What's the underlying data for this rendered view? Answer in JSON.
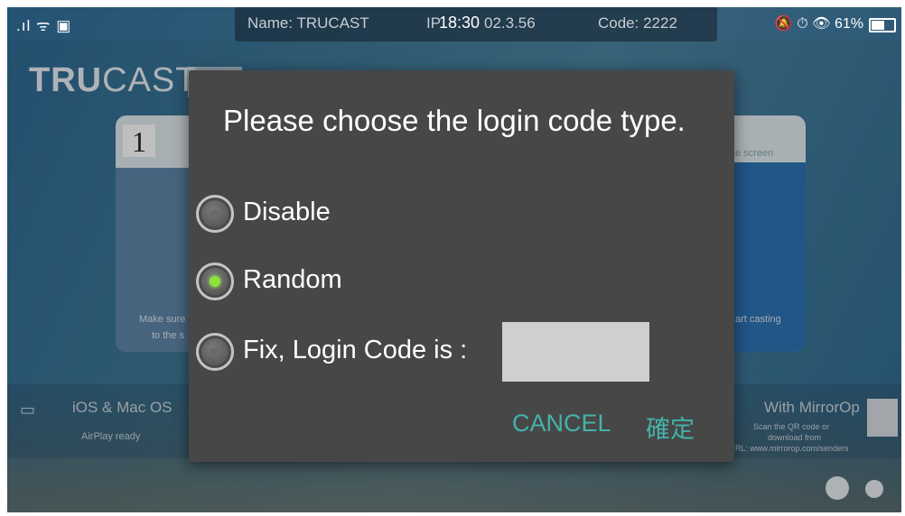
{
  "status_bar": {
    "signal_icons": ".ıl ᯤ ▣",
    "name_text": "Name: TRUCAST",
    "ip_text": "IP: 192.168.102.3.56",
    "ip_visible": "IP",
    "ip_tail": "02.3.56",
    "code_text": "Code: 2222",
    "time": "18:30",
    "right_icons": "🔕 ⏱ 👁",
    "battery": "61%"
  },
  "background": {
    "brand_bold": "TRU",
    "brand_rest": "CAST",
    "step_number": "1",
    "left_card_text_1": "Make sure",
    "left_card_text_2": "to the s",
    "right_card_header": "e screen",
    "right_card_text": "art casting",
    "bottom_left_title": "iOS & Mac OS",
    "bottom_left_sub": "AirPlay ready",
    "bottom_right_title": "With MirrorOp",
    "bottom_right_sub1": "Scan the QR code or",
    "bottom_right_sub2": "download from",
    "bottom_right_sub3": "RL: www.mirrorop.com/senders"
  },
  "dialog": {
    "title": "Please choose the login code type.",
    "options": [
      {
        "label": "Disable",
        "checked": false
      },
      {
        "label": "Random",
        "checked": true
      },
      {
        "label": "Fix, Login Code is :",
        "checked": false
      }
    ],
    "fixed_code_value": "",
    "cancel_label": "CANCEL",
    "confirm_label": "確定"
  },
  "colors": {
    "accent": "#43b3a9",
    "radio_checked": "#8ee33a",
    "dialog_bg": "#474747"
  }
}
